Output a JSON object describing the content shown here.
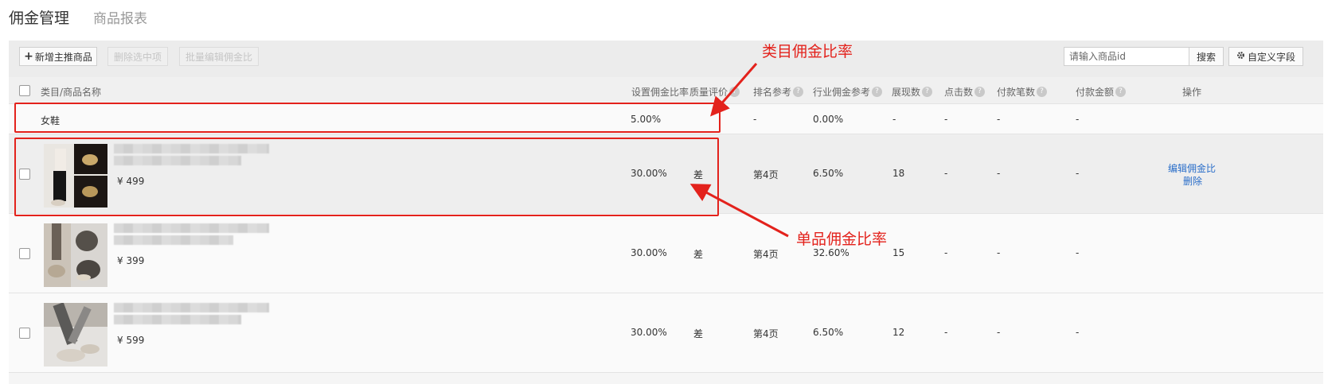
{
  "tabs": {
    "active": "佣金管理",
    "other": "商品报表"
  },
  "toolbar": {
    "add_label": "新增主推商品",
    "delete_label": "删除选中项",
    "batch_edit_label": "批量编辑佣金比",
    "search_placeholder": "请输入商品id",
    "search_label": "搜索",
    "custom_label": "自定义字段"
  },
  "columns": {
    "name": "类目/商品名称",
    "rate": "设置佣金比率",
    "quality": "质量评价",
    "rank": "排名参考",
    "industry": "行业佣金参考",
    "views": "展现数",
    "clicks": "点击数",
    "orders": "付款笔数",
    "amount": "付款金额",
    "ops": "操作"
  },
  "category_row": {
    "name": "女鞋",
    "rate": "5.00%",
    "rank": "-",
    "industry": "0.00%",
    "views": "-",
    "clicks": "-",
    "orders": "-",
    "amount": "-"
  },
  "products": [
    {
      "price": "¥ 499",
      "rate": "30.00%",
      "quality": "差",
      "rank": "第4页",
      "industry": "6.50%",
      "views": "18",
      "clicks": "-",
      "orders": "-",
      "amount": "-",
      "edit": "编辑佣金比",
      "delete": "删除"
    },
    {
      "price": "¥ 399",
      "rate": "30.00%",
      "quality": "差",
      "rank": "第4页",
      "industry": "32.60%",
      "views": "15",
      "clicks": "-",
      "orders": "-",
      "amount": "-"
    },
    {
      "price": "¥ 599",
      "rate": "30.00%",
      "quality": "差",
      "rank": "第4页",
      "industry": "6.50%",
      "views": "12",
      "clicks": "-",
      "orders": "-",
      "amount": "-"
    }
  ],
  "annotations": {
    "category": "类目佣金比率",
    "product": "单品佣金比率",
    "color": "#e3221c"
  },
  "colors": {
    "link": "#2a6ec9",
    "tab_active": "#333333",
    "tab_inactive": "#999999"
  },
  "icons": {
    "plus": "plus-icon",
    "gear": "gear-icon",
    "help": "question-icon"
  }
}
